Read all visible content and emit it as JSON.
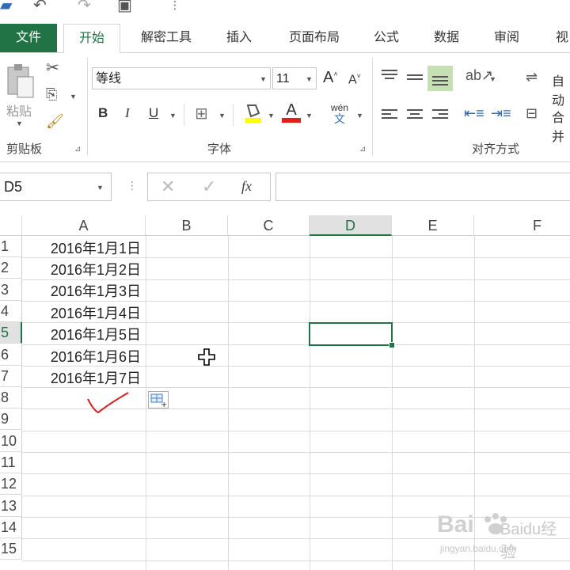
{
  "ribbon": {
    "tabs": [
      {
        "label": "文件"
      },
      {
        "label": "开始"
      },
      {
        "label": "解密工具"
      },
      {
        "label": "插入"
      },
      {
        "label": "页面布局"
      },
      {
        "label": "公式"
      },
      {
        "label": "数据"
      },
      {
        "label": "审阅"
      },
      {
        "label": "视"
      }
    ],
    "clipboard": {
      "paste_label": "粘贴",
      "group_label": "剪贴板"
    },
    "font": {
      "family": "等线",
      "size": "11",
      "group_label": "字体",
      "bold": "B",
      "italic": "I",
      "underline": "U",
      "phonetic": "wén"
    },
    "alignment": {
      "group_label": "对齐方式",
      "wrap_label": "自动",
      "merge_label": "合并"
    }
  },
  "formula_bar": {
    "name_box": "D5",
    "fx": "fx",
    "content": ""
  },
  "sheet": {
    "columns": [
      "A",
      "B",
      "C",
      "D",
      "E",
      "F"
    ],
    "selected_column": "D",
    "rows": [
      "1",
      "2",
      "3",
      "4",
      "5",
      "6",
      "7",
      "8",
      "9",
      "10",
      "11",
      "12",
      "13",
      "14",
      "15"
    ],
    "selected_row": "5",
    "cells_A": [
      "2016年1月1日",
      "2016年1月2日",
      "2016年1月3日",
      "2016年1月4日",
      "2016年1月5日",
      "2016年1月6日",
      "2016年1月7日"
    ],
    "active_cell": "D5"
  },
  "watermark": {
    "brand": "Baidu经验",
    "url": "jingyan.baidu.com"
  },
  "colors": {
    "accent": "#217346",
    "annotation": "#d42020"
  }
}
